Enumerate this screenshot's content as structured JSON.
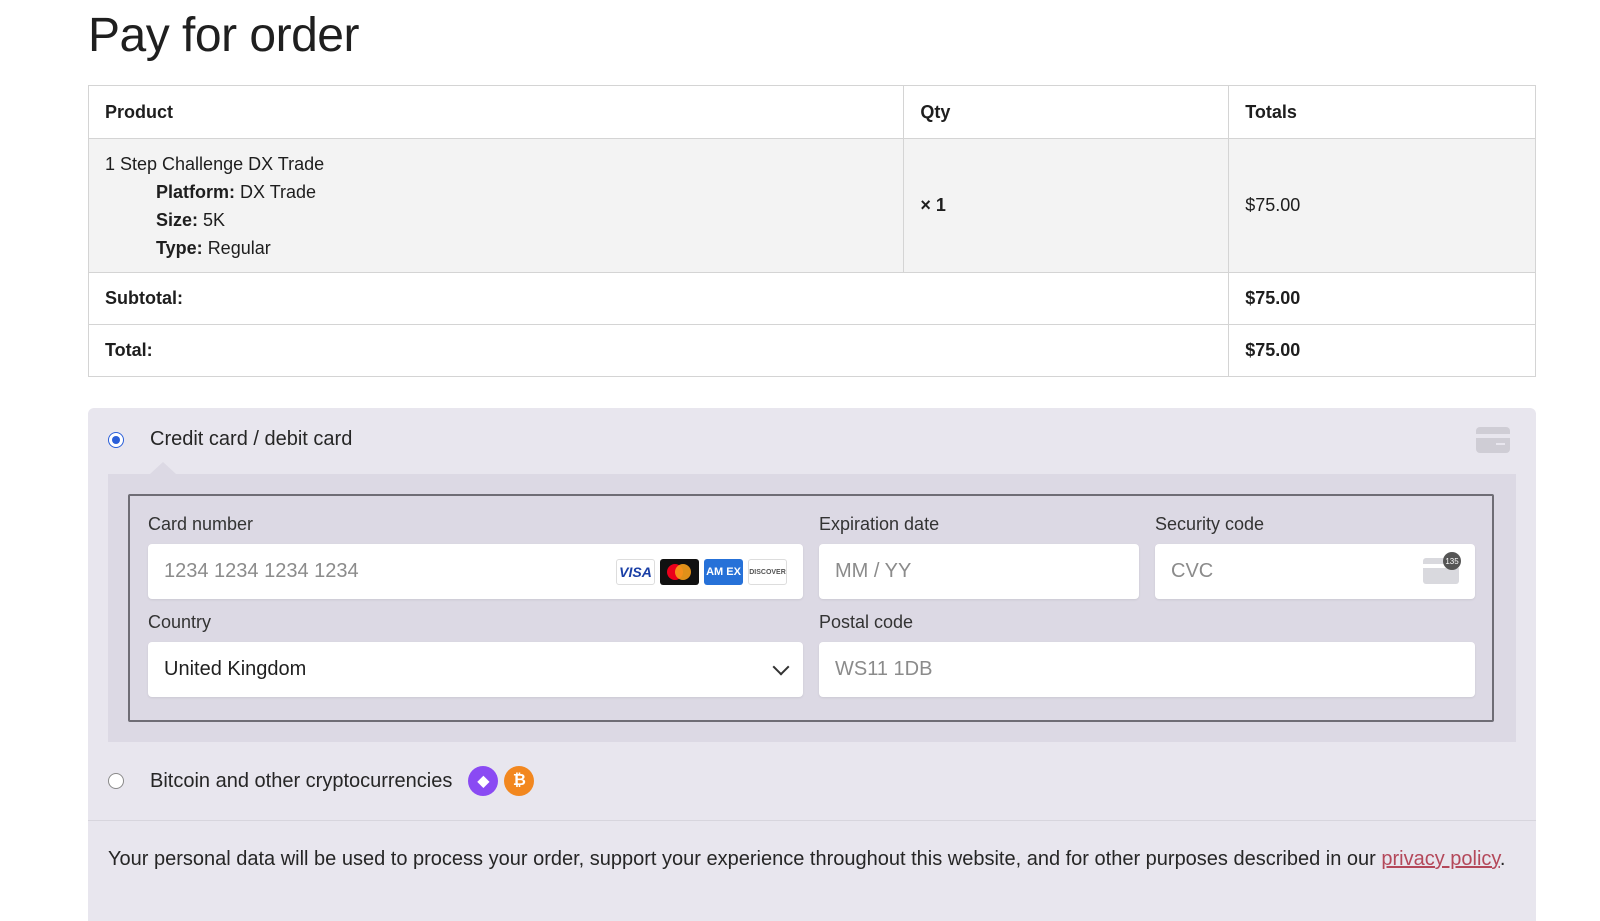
{
  "page": {
    "title": "Pay for order"
  },
  "order_table": {
    "headers": {
      "product": "Product",
      "qty": "Qty",
      "totals": "Totals"
    },
    "item": {
      "name": "1 Step Challenge DX Trade",
      "meta": [
        {
          "key": "Platform:",
          "value": "DX Trade"
        },
        {
          "key": "Size:",
          "value": "5K"
        },
        {
          "key": "Type:",
          "value": "Regular"
        }
      ],
      "qty": "× 1",
      "total": "$75.00"
    },
    "subtotal": {
      "label": "Subtotal:",
      "value": "$75.00"
    },
    "total": {
      "label": "Total:",
      "value": "$75.00"
    }
  },
  "payment": {
    "card_method": {
      "label": "Credit card / debit card",
      "selected": true,
      "icon": "credit-card-icon"
    },
    "card_form": {
      "card_number": {
        "label": "Card number",
        "placeholder": "1234 1234 1234 1234",
        "brands": [
          "VISA",
          "Mastercard",
          "AMEX",
          "DISCOVER"
        ]
      },
      "expiration": {
        "label": "Expiration date",
        "placeholder": "MM / YY"
      },
      "security": {
        "label": "Security code",
        "placeholder": "CVC",
        "badge": "135"
      },
      "country": {
        "label": "Country",
        "value": "United Kingdom"
      },
      "postal": {
        "label": "Postal code",
        "placeholder": "WS11 1DB"
      }
    },
    "crypto_method": {
      "label": "Bitcoin and other cryptocurrencies",
      "selected": false,
      "icons": [
        "ethereum-icon",
        "bitcoin-icon"
      ]
    },
    "privacy": {
      "text": "Your personal data will be used to process your order, support your experience throughout this website, and for other purposes described in our ",
      "link": "privacy policy",
      "end": "."
    }
  },
  "colors": {
    "radio_selected": "#2b5fd9",
    "link": "#b4485a",
    "payment_bg": "#e8e6ee",
    "ethereum": "#8a4af3",
    "bitcoin": "#f2871f"
  }
}
